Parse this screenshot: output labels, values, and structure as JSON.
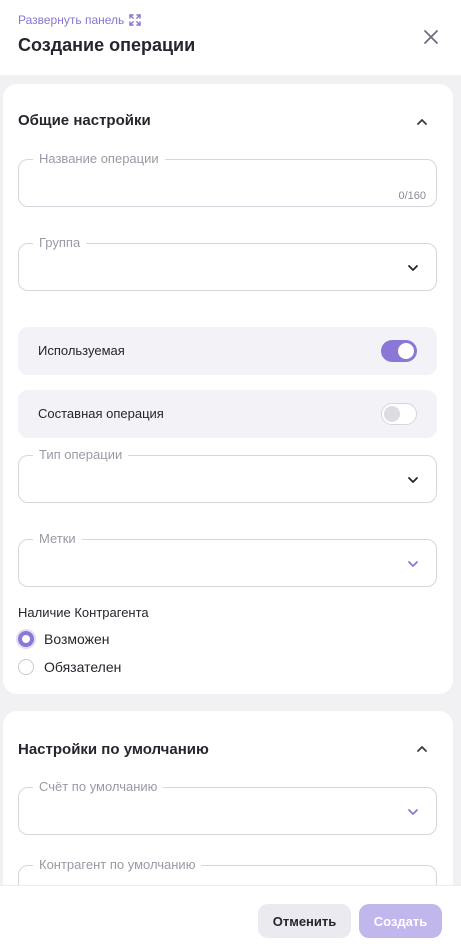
{
  "header": {
    "expand_label": "Развернуть панель",
    "title": "Создание операции"
  },
  "general": {
    "title": "Общие настройки",
    "name_field": {
      "label": "Название операции",
      "value": "",
      "counter": "0/160"
    },
    "group_field": {
      "label": "Группа",
      "value": ""
    },
    "used_toggle": {
      "label": "Используемая",
      "on": true
    },
    "composite_toggle": {
      "label": "Составная операция",
      "on": false
    },
    "type_field": {
      "label": "Тип операции",
      "value": ""
    },
    "tags_field": {
      "label": "Метки",
      "value": ""
    },
    "counterparty": {
      "label": "Наличие Контрагента",
      "options": [
        {
          "label": "Возможен",
          "checked": true
        },
        {
          "label": "Обязателен",
          "checked": false
        }
      ]
    }
  },
  "defaults": {
    "title": "Настройки по умолчанию",
    "account_field": {
      "label": "Счёт по умолчанию",
      "value": ""
    },
    "counterparty_field": {
      "label": "Контрагент по умолчанию",
      "value": ""
    }
  },
  "footer": {
    "cancel_label": "Отменить",
    "create_label": "Создать"
  },
  "colors": {
    "accent": "#8b78d6",
    "accent_light": "#c2b7ec",
    "background": "#f1f1f4"
  }
}
